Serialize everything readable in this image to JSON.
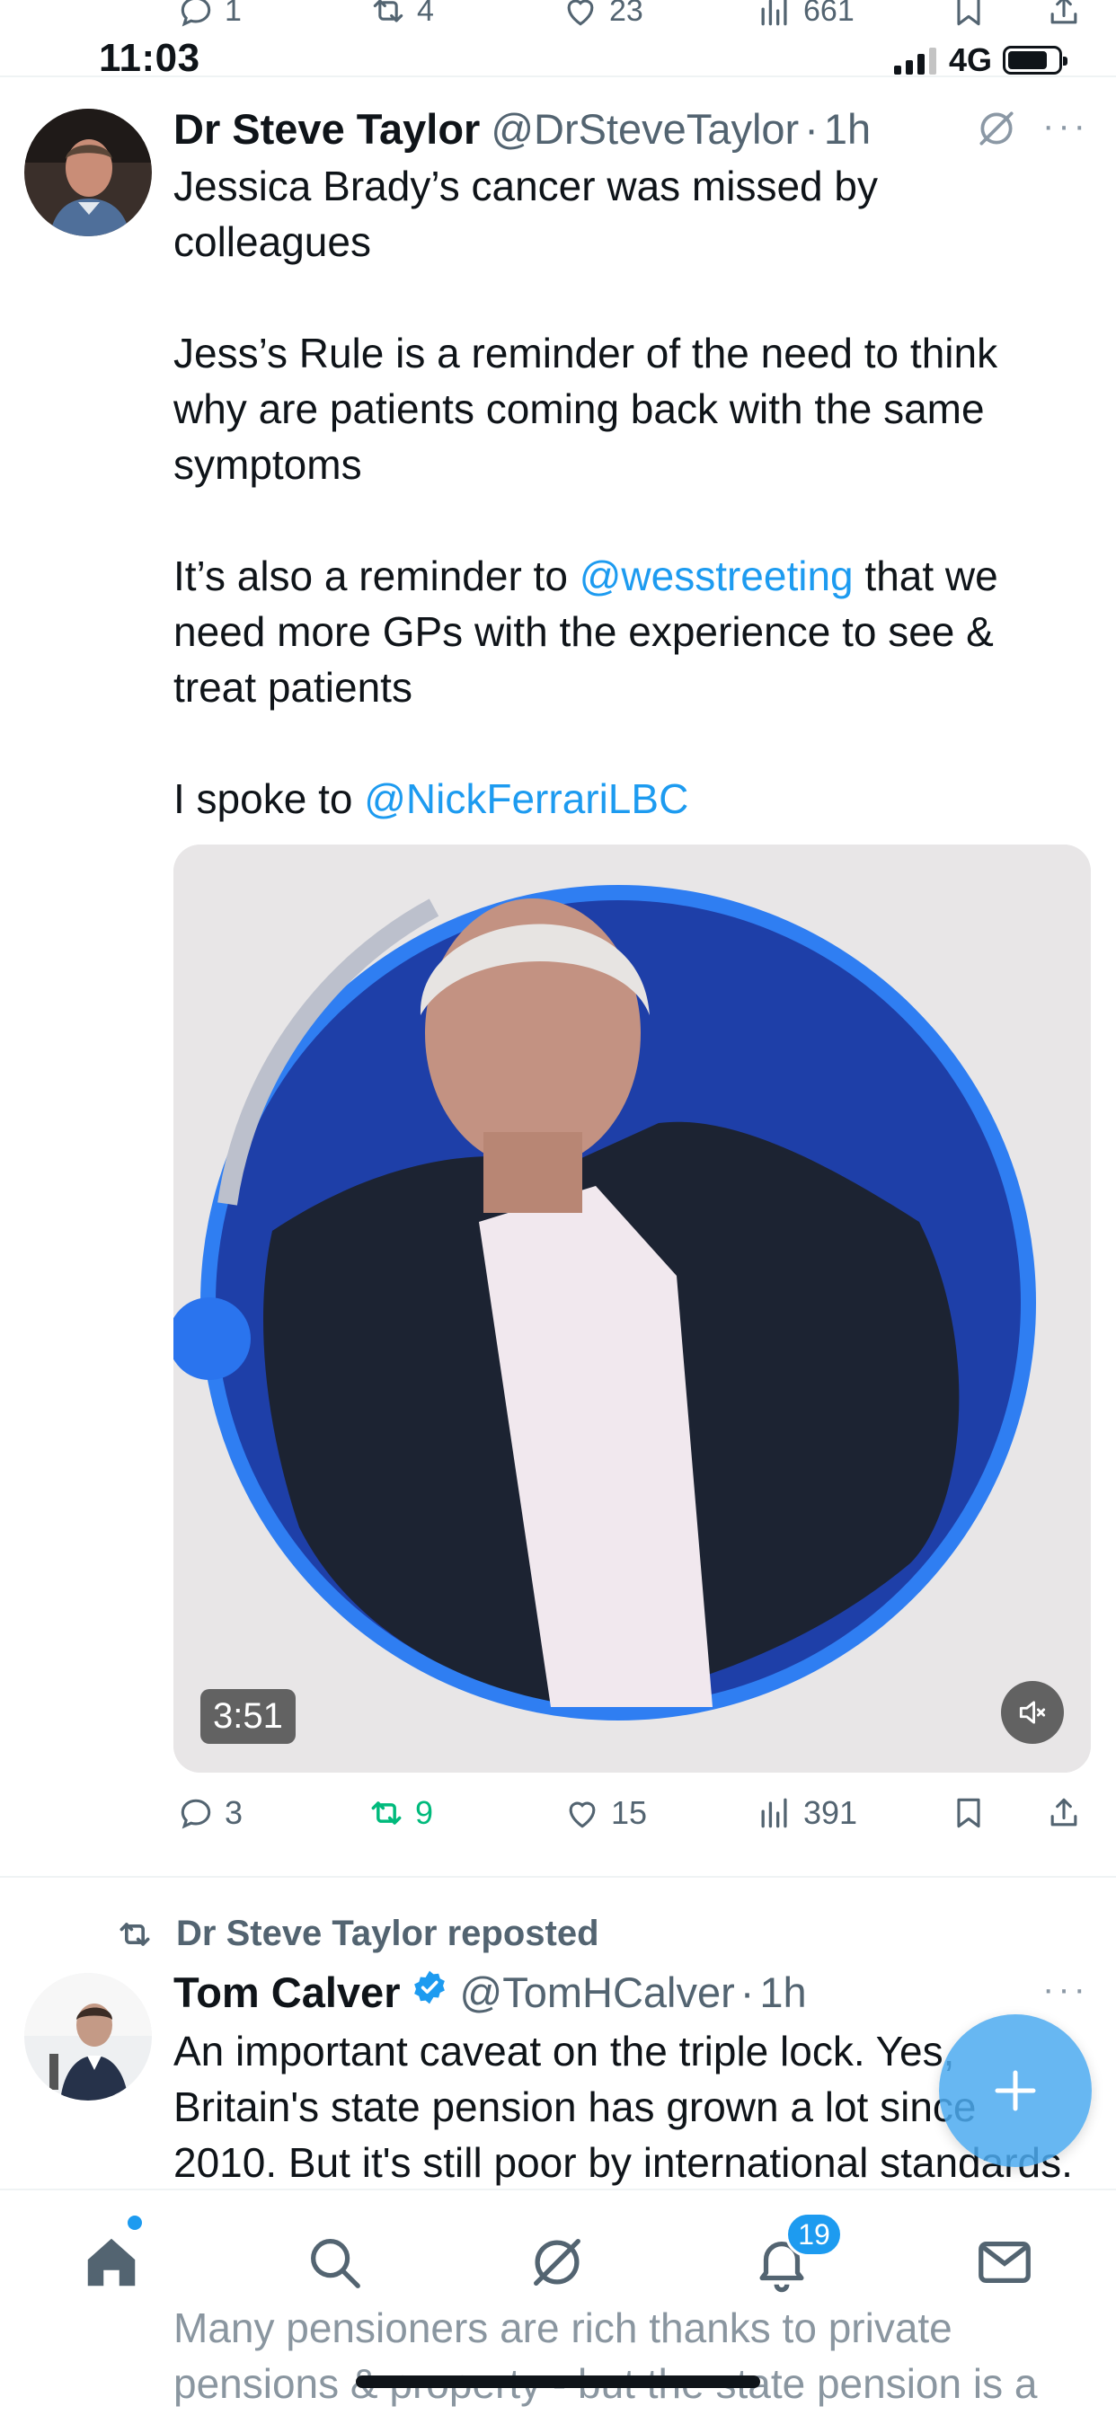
{
  "prev_tweet": {
    "replies": "1",
    "reposts": "4",
    "likes": "23",
    "views": "661"
  },
  "status_bar": {
    "time": "11:03",
    "network": "4G"
  },
  "tweet": {
    "author_name": "Dr Steve Taylor",
    "author_handle": "@DrSteveTaylor",
    "dot": "·",
    "time_ago": "1h",
    "more": "···",
    "line1": "Jessica Brady’s cancer was missed by colleagues",
    "line2": "Jess’s Rule is a reminder of the need to think why are patients coming back with the same symptoms",
    "line3_prefix": "It’s also a reminder to ",
    "line3_mention": "@wesstreeting",
    "line3_suffix": " that we need more GPs with the experience to see & treat patients",
    "line4_prefix": "I spoke to ",
    "line4_mention": "@NickFerrariLBC",
    "media": {
      "duration": "3:51"
    },
    "replies": "3",
    "reposts": "9",
    "likes": "15",
    "views": "391"
  },
  "repost": {
    "label": "Dr Steve Taylor reposted",
    "author_name": "Tom Calver",
    "author_handle": "@TomHCalver",
    "dot": "·",
    "time_ago": "1h",
    "more": "···",
    "text": "An important caveat on the triple lock. Yes, Britain's state pension has grown a lot since 2010. But it's still poor by international standards.",
    "text_continued": "Many pensioners are rich thanks to private pensions & property - but the state pension is a"
  },
  "tab_bar": {
    "notifications_badge": "19",
    "tabs": [
      "home",
      "search",
      "grok",
      "notifications",
      "messages"
    ]
  },
  "colors": {
    "accent": "#1d9bf0",
    "repost_green": "#00ba7c",
    "secondary_text": "#536471"
  }
}
